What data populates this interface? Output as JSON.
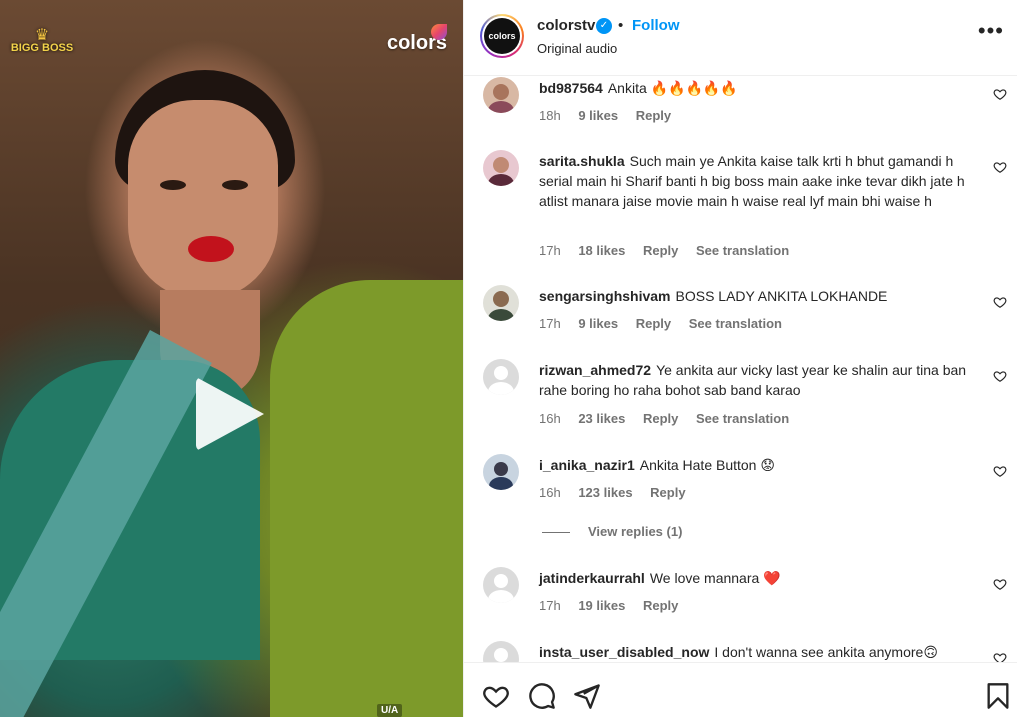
{
  "media": {
    "show_logo": "BIGG BOSS",
    "channel_logo": "colors",
    "rating": "U/A"
  },
  "header": {
    "username": "colorstv",
    "verified": true,
    "separator": "•",
    "follow_label": "Follow",
    "audio": "Original audio",
    "avatar_text": "colors"
  },
  "comments": [
    {
      "username": "bd987564",
      "text": "Ankita 🔥🔥🔥🔥🔥",
      "time": "18h",
      "likes": "9 likes",
      "reply": "Reply",
      "translation": "",
      "avatar_color": "#c9a28a"
    },
    {
      "username": "sarita.shukla",
      "text": "Such main ye Ankita kaise talk krti h bhut gamandi h serial main hi Sharif banti h big boss main aake inke tevar dikh jate h atlist manara jaise movie main h waise real lyf main bhi waise h",
      "time": "17h",
      "likes": "18 likes",
      "reply": "Reply",
      "translation": "See translation",
      "avatar_color": "#b06a7a"
    },
    {
      "username": "sengarsinghshivam",
      "text": "BOSS LADY ANKITA LOKHANDE",
      "time": "17h",
      "likes": "9 likes",
      "reply": "Reply",
      "translation": "See translation",
      "avatar_color": "#6a7a5a"
    },
    {
      "username": "rizwan_ahmed72",
      "text": "Ye ankita aur vicky last year ke shalin aur tina ban rahe boring ho raha bohot sab band karao",
      "time": "16h",
      "likes": "23 likes",
      "reply": "Reply",
      "translation": "See translation",
      "avatar_color": ""
    },
    {
      "username": "i_anika_nazir1",
      "text": "Ankita Hate Button 😟",
      "time": "16h",
      "likes": "123 likes",
      "reply": "Reply",
      "translation": "",
      "avatar_color": "#4a5a7a"
    },
    {
      "username": "jatinderkaurrahl",
      "text": "We love mannara ❤️",
      "time": "17h",
      "likes": "19 likes",
      "reply": "Reply",
      "translation": "",
      "avatar_color": ""
    },
    {
      "username": "insta_user_disabled_now",
      "text": "I don't wanna see ankita anymore🙃",
      "time": "",
      "likes": "",
      "reply": "",
      "translation": "",
      "avatar_color": ""
    }
  ],
  "view_replies": "View replies (1)",
  "actions": {
    "like": "heart-icon",
    "comment": "comment-icon",
    "share": "share-icon",
    "save": "bookmark-icon"
  }
}
